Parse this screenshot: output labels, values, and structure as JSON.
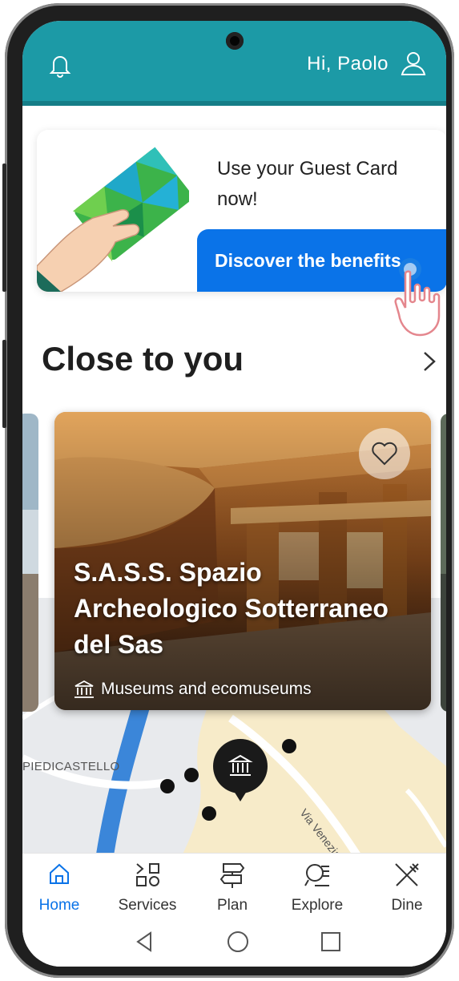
{
  "header": {
    "greeting": "Hi, Paolo",
    "bell_icon": "bell-icon",
    "user_icon": "user-icon",
    "color": "#1c9aa6"
  },
  "promo": {
    "text": "Use your Guest Card now!",
    "button_label": "Discover the benefits",
    "button_color": "#0a73e8"
  },
  "section": {
    "title": "Close to you",
    "more_icon": "chevron-right-icon"
  },
  "card": {
    "title": "S.A.S.S. Spazio Archeologico Sotterraneo del Sas",
    "category": "Museums and ecomuseums",
    "category_icon": "museum-icon",
    "favorite_icon": "heart-icon"
  },
  "map": {
    "area_label": "PIEDICASTELLO",
    "street_label": "Via Venezia",
    "pin_icon": "museum-pin-icon"
  },
  "tabs": [
    {
      "label": "Home",
      "icon": "home-icon",
      "active": true
    },
    {
      "label": "Services",
      "icon": "services-icon",
      "active": false
    },
    {
      "label": "Plan",
      "icon": "signpost-icon",
      "active": false
    },
    {
      "label": "Explore",
      "icon": "explore-icon",
      "active": false
    },
    {
      "label": "Dine",
      "icon": "fork-knife-icon",
      "active": false
    }
  ],
  "system_nav": [
    "back-icon",
    "home-circle-icon",
    "recents-icon"
  ]
}
